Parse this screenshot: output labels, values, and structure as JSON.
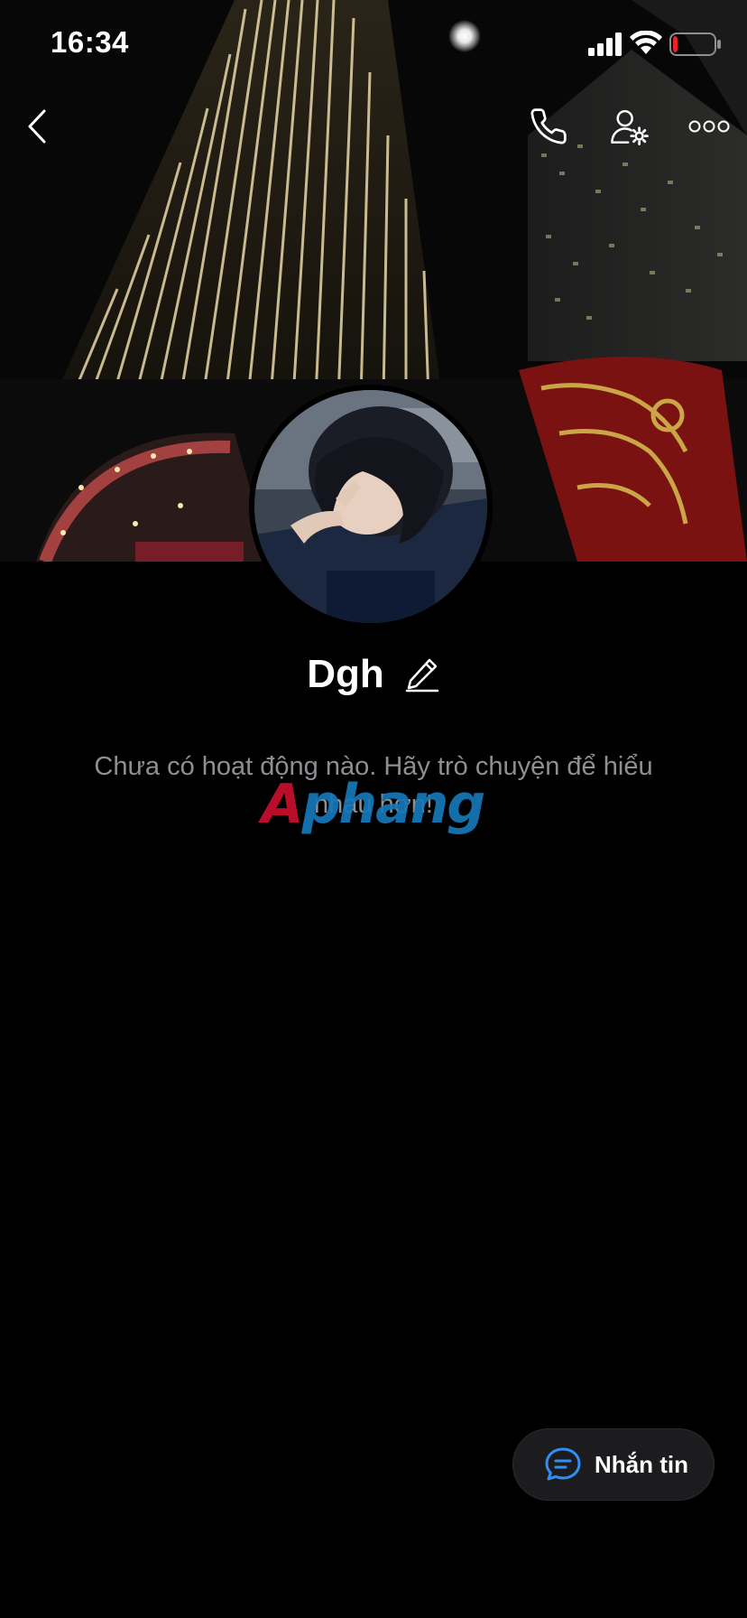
{
  "status_bar": {
    "time": "16:34",
    "battery_level": 0.12,
    "battery_color": "#e5252a"
  },
  "nav": {
    "back_icon": "chevron-left-icon",
    "call_icon": "phone-icon",
    "user_settings_icon": "user-settings-icon",
    "more_icon": "more-horizontal-icon"
  },
  "profile": {
    "name": "Dgh",
    "edit_icon": "pencil-icon"
  },
  "empty_state": {
    "text": "Chưa có hoạt động nào. Hãy trò chuyện để hiểu nhau hơn!"
  },
  "watermark": {
    "first_letter": "A",
    "rest": "phang"
  },
  "message_button": {
    "icon": "chat-bubble-icon",
    "label": "Nhắn tin",
    "icon_color": "#2f8ff5"
  },
  "colors": {
    "background": "#000000",
    "text_primary": "#ffffff",
    "text_secondary": "#8e8e93",
    "fab_background": "#1c1c1e"
  }
}
